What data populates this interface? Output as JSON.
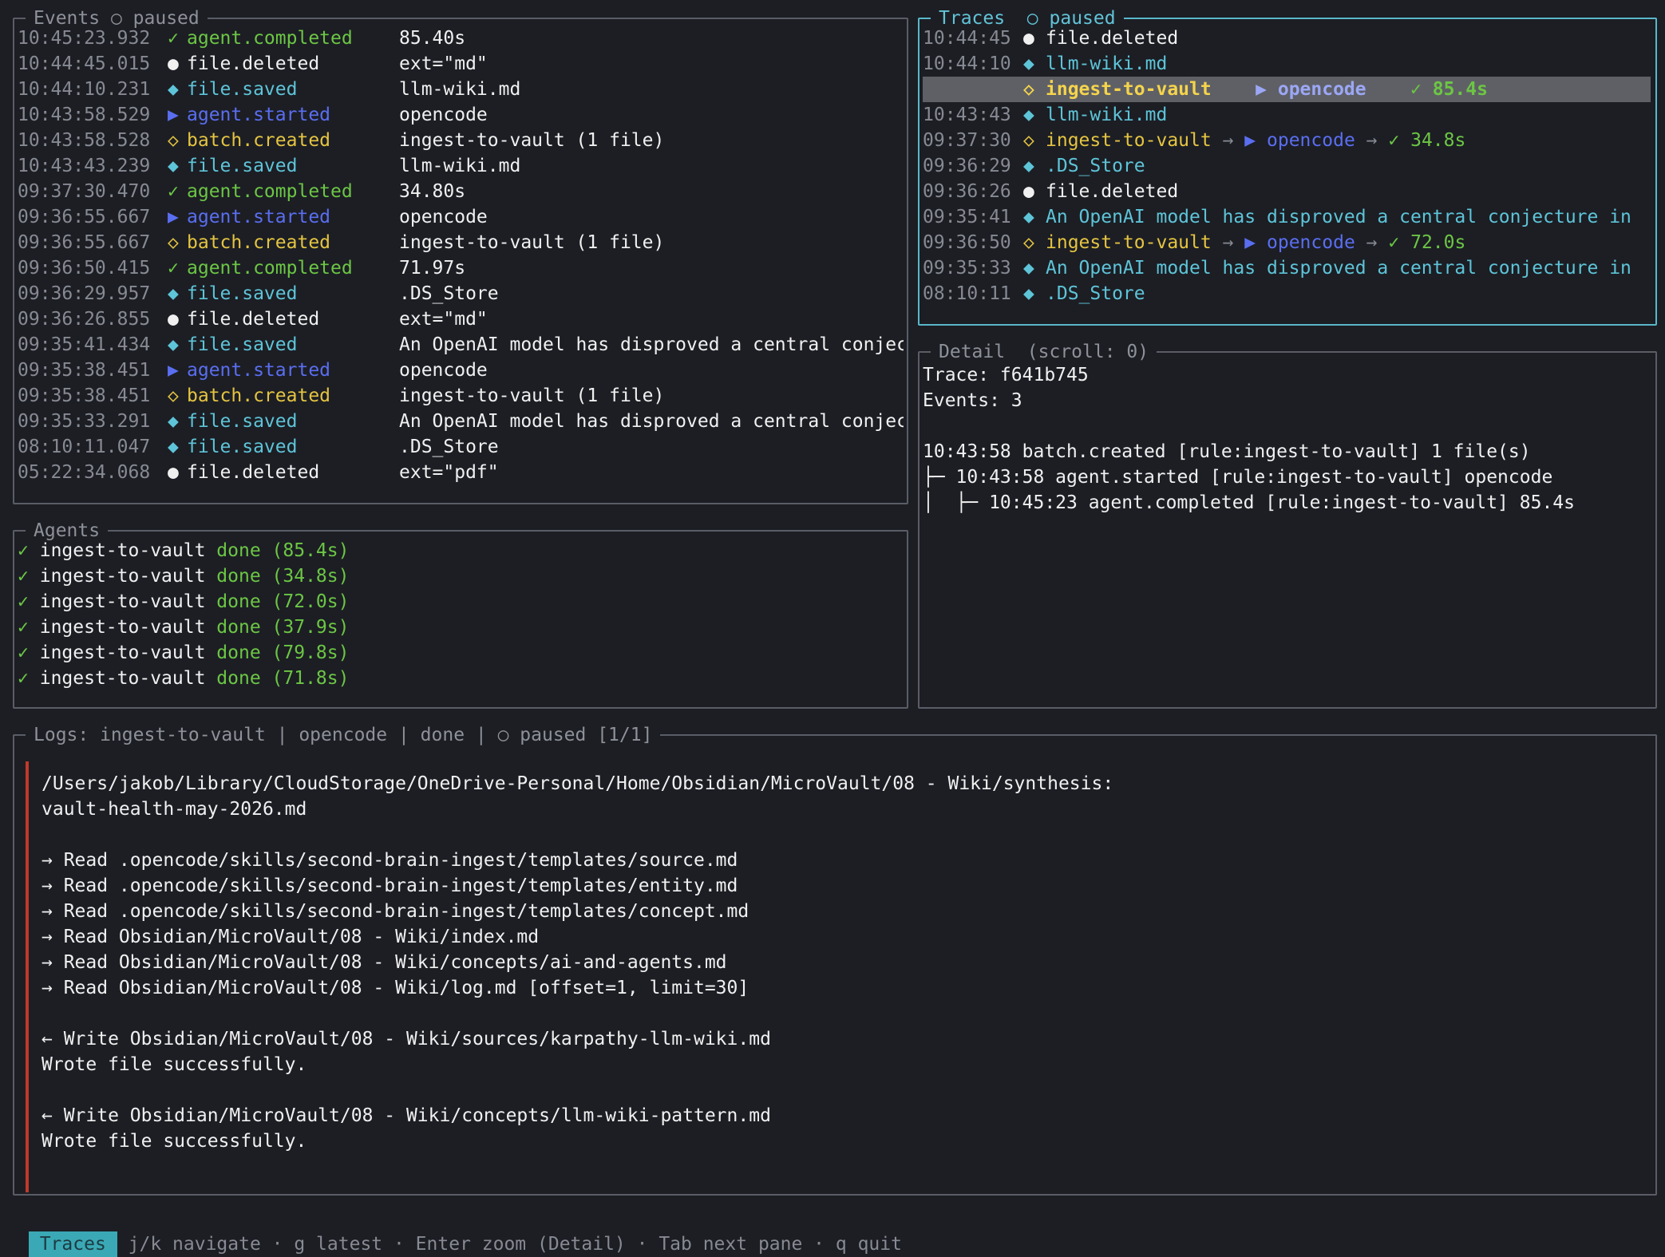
{
  "events": {
    "title": "Events",
    "status_icon": "○",
    "status": "paused",
    "rows": [
      {
        "time": "10:45:23.932",
        "icon": "✓",
        "name": "agent.completed",
        "detail": "85.40s",
        "color": "green"
      },
      {
        "time": "10:44:45.015",
        "icon": "●",
        "name": "file.deleted",
        "detail": "ext=\"md\"",
        "color": "white"
      },
      {
        "time": "10:44:10.231",
        "icon": "◆",
        "name": "file.saved",
        "detail": "llm-wiki.md",
        "color": "cyan"
      },
      {
        "time": "10:43:58.529",
        "icon": "▶",
        "name": "agent.started",
        "detail": "opencode",
        "color": "blue"
      },
      {
        "time": "10:43:58.528",
        "icon": "◇",
        "name": "batch.created",
        "detail": "ingest-to-vault (1 file)",
        "color": "yellow"
      },
      {
        "time": "10:43:43.239",
        "icon": "◆",
        "name": "file.saved",
        "detail": "llm-wiki.md",
        "color": "cyan"
      },
      {
        "time": "09:37:30.470",
        "icon": "✓",
        "name": "agent.completed",
        "detail": "34.80s",
        "color": "green"
      },
      {
        "time": "09:36:55.667",
        "icon": "▶",
        "name": "agent.started",
        "detail": "opencode",
        "color": "blue"
      },
      {
        "time": "09:36:55.667",
        "icon": "◇",
        "name": "batch.created",
        "detail": "ingest-to-vault (1 file)",
        "color": "yellow"
      },
      {
        "time": "09:36:50.415",
        "icon": "✓",
        "name": "agent.completed",
        "detail": "71.97s",
        "color": "green"
      },
      {
        "time": "09:36:29.957",
        "icon": "◆",
        "name": "file.saved",
        "detail": ".DS_Store",
        "color": "cyan"
      },
      {
        "time": "09:36:26.855",
        "icon": "●",
        "name": "file.deleted",
        "detail": "ext=\"md\"",
        "color": "white"
      },
      {
        "time": "09:35:41.434",
        "icon": "◆",
        "name": "file.saved",
        "detail": "An OpenAI model has disproved a central conjec",
        "color": "cyan"
      },
      {
        "time": "09:35:38.451",
        "icon": "▶",
        "name": "agent.started",
        "detail": "opencode",
        "color": "blue"
      },
      {
        "time": "09:35:38.451",
        "icon": "◇",
        "name": "batch.created",
        "detail": "ingest-to-vault (1 file)",
        "color": "yellow"
      },
      {
        "time": "09:35:33.291",
        "icon": "◆",
        "name": "file.saved",
        "detail": "An OpenAI model has disproved a central conjec",
        "color": "cyan"
      },
      {
        "time": "08:10:11.047",
        "icon": "◆",
        "name": "file.saved",
        "detail": ".DS_Store",
        "color": "cyan"
      },
      {
        "time": "05:22:34.068",
        "icon": "●",
        "name": "file.deleted",
        "detail": "ext=\"pdf\"",
        "color": "white"
      }
    ]
  },
  "agents": {
    "title": "Agents",
    "rows": [
      {
        "icon": "✓",
        "name": "ingest-to-vault",
        "status": "done",
        "duration": "(85.4s)"
      },
      {
        "icon": "✓",
        "name": "ingest-to-vault",
        "status": "done",
        "duration": "(34.8s)"
      },
      {
        "icon": "✓",
        "name": "ingest-to-vault",
        "status": "done",
        "duration": "(72.0s)"
      },
      {
        "icon": "✓",
        "name": "ingest-to-vault",
        "status": "done",
        "duration": "(37.9s)"
      },
      {
        "icon": "✓",
        "name": "ingest-to-vault",
        "status": "done",
        "duration": "(79.8s)"
      },
      {
        "icon": "✓",
        "name": "ingest-to-vault",
        "status": "done",
        "duration": "(71.8s)"
      }
    ]
  },
  "traces": {
    "title": "Traces",
    "status_icon": "○",
    "status": "paused",
    "rows": [
      {
        "time": "10:44:45",
        "icon": "●",
        "icon_color": "white",
        "text": "file.deleted",
        "color": "white"
      },
      {
        "time": "10:44:10",
        "icon": "◆",
        "icon_color": "cyan",
        "text": "llm-wiki.md",
        "color": "cyan"
      },
      {
        "time": "",
        "icon": "◇",
        "icon_color": "yellow",
        "text": "ingest-to-vault",
        "color": "yellow",
        "selected": true,
        "agent_icon": "▶",
        "agent": "opencode",
        "result_icon": "✓",
        "result": "85.4s"
      },
      {
        "time": "10:43:43",
        "icon": "◆",
        "icon_color": "cyan",
        "text": "llm-wiki.md",
        "color": "cyan"
      },
      {
        "time": "09:37:30",
        "icon": "◇",
        "icon_color": "yellow",
        "text": "ingest-to-vault",
        "color": "yellow",
        "arrow": "→",
        "agent_icon": "▶",
        "agent": "opencode",
        "result_icon": "✓",
        "result": "34.8s"
      },
      {
        "time": "09:36:29",
        "icon": "◆",
        "icon_color": "cyan",
        "text": ".DS_Store",
        "color": "cyan"
      },
      {
        "time": "09:36:26",
        "icon": "●",
        "icon_color": "white",
        "text": "file.deleted",
        "color": "white"
      },
      {
        "time": "09:35:41",
        "icon": "◆",
        "icon_color": "cyan",
        "text": "An OpenAI model has disproved a central conjecture in",
        "color": "cyan"
      },
      {
        "time": "09:36:50",
        "icon": "◇",
        "icon_color": "yellow",
        "text": "ingest-to-vault",
        "color": "yellow",
        "arrow": "→",
        "agent_icon": "▶",
        "agent": "opencode",
        "result_icon": "✓",
        "result": "72.0s"
      },
      {
        "time": "09:35:33",
        "icon": "◆",
        "icon_color": "cyan",
        "text": "An OpenAI model has disproved a central conjecture in",
        "color": "cyan"
      },
      {
        "time": "08:10:11",
        "icon": "◆",
        "icon_color": "cyan",
        "text": ".DS_Store",
        "color": "cyan"
      }
    ]
  },
  "detail": {
    "title": "Detail",
    "scroll": "(scroll: 0)",
    "lines": [
      "Trace: f641b745",
      "Events: 3",
      "",
      "10:43:58 batch.created [rule:ingest-to-vault] 1 file(s)",
      "├─ 10:43:58 agent.started [rule:ingest-to-vault] opencode",
      "│  ├─ 10:45:23 agent.completed [rule:ingest-to-vault] 85.4s"
    ]
  },
  "logs": {
    "title": "Logs: ingest-to-vault | opencode | done | ○ paused [1/1]",
    "lines": [
      "/Users/jakob/Library/CloudStorage/OneDrive-Personal/Home/Obsidian/MicroVault/08 - Wiki/synthesis:",
      "vault-health-may-2026.md",
      "",
      "→ Read .opencode/skills/second-brain-ingest/templates/source.md",
      "→ Read .opencode/skills/second-brain-ingest/templates/entity.md",
      "→ Read .opencode/skills/second-brain-ingest/templates/concept.md",
      "→ Read Obsidian/MicroVault/08 - Wiki/index.md",
      "→ Read Obsidian/MicroVault/08 - Wiki/concepts/ai-and-agents.md",
      "→ Read Obsidian/MicroVault/08 - Wiki/log.md [offset=1, limit=30]",
      "",
      "← Write Obsidian/MicroVault/08 - Wiki/sources/karpathy-llm-wiki.md",
      "Wrote file successfully.",
      "",
      "← Write Obsidian/MicroVault/08 - Wiki/concepts/llm-wiki-pattern.md",
      "Wrote file successfully."
    ]
  },
  "statusbar": {
    "mode": "Traces",
    "hints": "j/k navigate · g latest · Enter zoom (Detail) · Tab next pane · q quit"
  }
}
